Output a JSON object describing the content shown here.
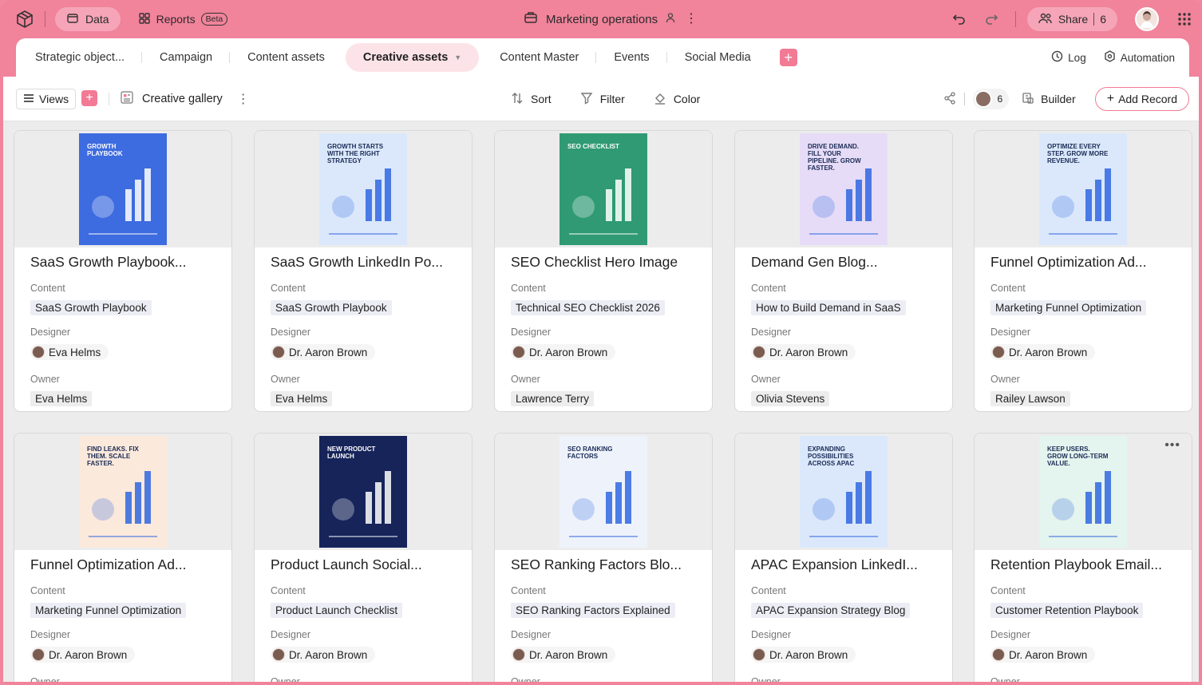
{
  "topbar": {
    "data_label": "Data",
    "reports_label": "Reports",
    "beta_label": "Beta",
    "workspace_title": "Marketing operations",
    "share_label": "Share",
    "share_count": "6"
  },
  "tabs": [
    {
      "label": "Strategic object..."
    },
    {
      "label": "Campaign"
    },
    {
      "label": "Content assets"
    },
    {
      "label": "Creative assets"
    },
    {
      "label": "Content Master"
    },
    {
      "label": "Events"
    },
    {
      "label": "Social Media"
    }
  ],
  "tabright": {
    "log_label": "Log",
    "automation_label": "Automation"
  },
  "toolbar": {
    "views_label": "Views",
    "gallery_label": "Creative gallery",
    "sort_label": "Sort",
    "filter_label": "Filter",
    "color_label": "Color",
    "collab_count": "6",
    "builder_label": "Builder",
    "add_record_label": "Add Record"
  },
  "fields": {
    "content": "Content",
    "designer": "Designer",
    "owner": "Owner"
  },
  "cards": [
    {
      "title": "SaaS Growth Playbook...",
      "content": "SaaS Growth Playbook",
      "designer": "Eva Helms",
      "owner": "Eva Helms",
      "thumb_text": "Growth Playbook",
      "thumb_bg": "#3d6be0"
    },
    {
      "title": "SaaS Growth LinkedIn Po...",
      "content": "SaaS Growth Playbook",
      "designer": "Dr. Aaron Brown",
      "owner": "Eva Helms",
      "thumb_text": "Growth starts with the right strategy",
      "thumb_bg": "#dbe8fb"
    },
    {
      "title": "SEO Checklist Hero Image",
      "content": "Technical SEO Checklist 2026",
      "designer": "Dr. Aaron Brown",
      "owner": "Lawrence Terry",
      "thumb_text": "SEO Checklist",
      "thumb_bg": "#2f9a74"
    },
    {
      "title": "Demand Gen Blog...",
      "content": "How to Build Demand in SaaS",
      "designer": "Dr. Aaron Brown",
      "owner": "Olivia Stevens",
      "thumb_text": "Drive demand. Fill your pipeline. Grow faster.",
      "thumb_bg": "#e6dcf7"
    },
    {
      "title": "Funnel Optimization Ad...",
      "content": "Marketing Funnel Optimization",
      "designer": "Dr. Aaron Brown",
      "owner": "Railey Lawson",
      "thumb_text": "Optimize every step. Grow more revenue.",
      "thumb_bg": "#dbe8fb"
    },
    {
      "title": "Funnel Optimization Ad...",
      "content": "Marketing Funnel Optimization",
      "designer": "Dr. Aaron Brown",
      "owner": "",
      "thumb_text": "Find leaks. Fix them. Scale faster.",
      "thumb_bg": "#fbe9dc"
    },
    {
      "title": "Product Launch Social...",
      "content": "Product Launch Checklist",
      "designer": "Dr. Aaron Brown",
      "owner": "",
      "thumb_text": "New product launch",
      "thumb_bg": "#16245a"
    },
    {
      "title": "SEO Ranking Factors Blo...",
      "content": "SEO Ranking Factors Explained",
      "designer": "Dr. Aaron Brown",
      "owner": "",
      "thumb_text": "SEO ranking factors",
      "thumb_bg": "#eef3fb"
    },
    {
      "title": "APAC Expansion LinkedI...",
      "content": "APAC Expansion Strategy Blog",
      "designer": "Dr. Aaron Brown",
      "owner": "",
      "thumb_text": "Expanding possibilities across APAC",
      "thumb_bg": "#dbe8fb"
    },
    {
      "title": "Retention Playbook Email...",
      "content": "Customer Retention Playbook",
      "designer": "Dr. Aaron Brown",
      "owner": "",
      "thumb_text": "Keep users. Grow long-term value.",
      "thumb_bg": "#e4f4ee"
    }
  ],
  "icons": {
    "logo": "box-logo-icon",
    "data": "database-icon",
    "reports": "grid-icon",
    "undo": "undo-icon",
    "redo": "redo-icon",
    "share": "users-icon",
    "apps": "apps-grid-icon",
    "log": "clock-icon",
    "automation": "automation-icon",
    "views": "menu-icon",
    "sort": "sort-icon",
    "filter": "filter-icon",
    "color": "paint-bucket-icon",
    "builder": "builder-icon",
    "collab": "share-graph-icon"
  },
  "colors": {
    "brand": "#f1839b",
    "accent": "#f27a95",
    "chip": "#ededf6"
  }
}
